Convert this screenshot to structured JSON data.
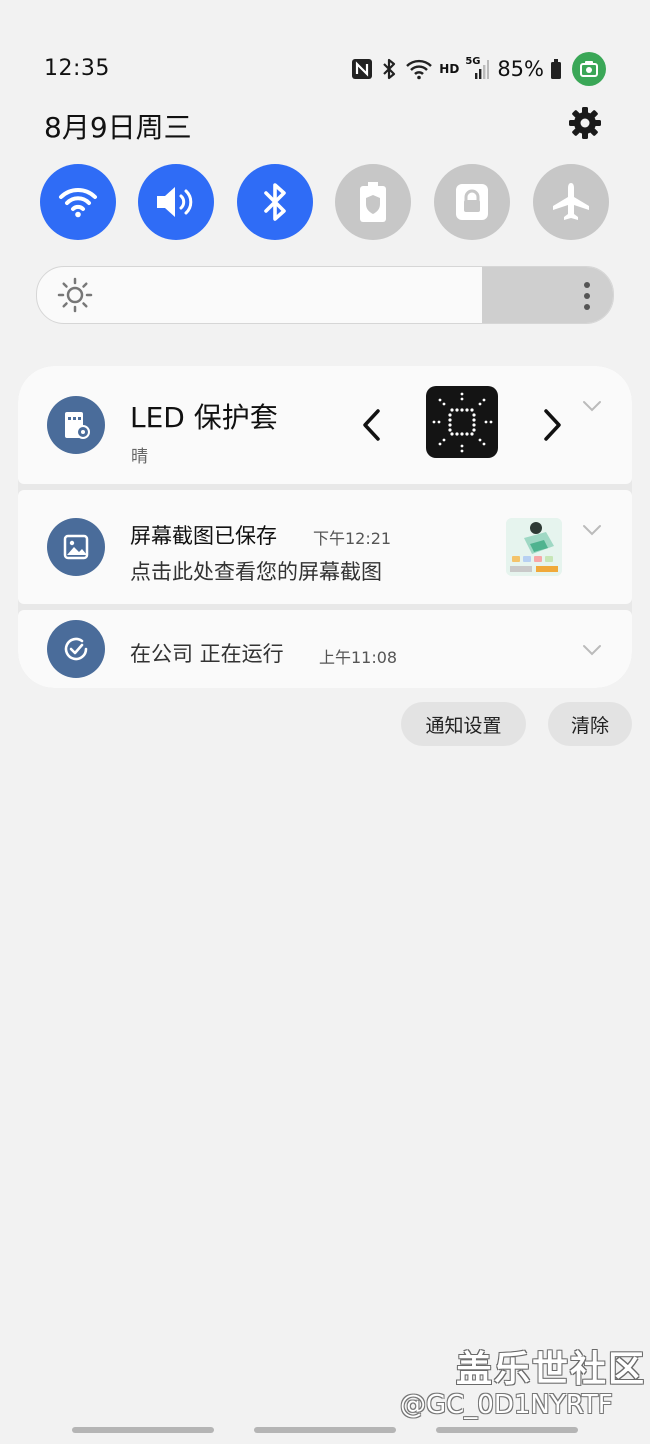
{
  "status_bar": {
    "time": "12:35",
    "network_hd": "HD",
    "network_5g": "5G",
    "battery": "85%",
    "icons": [
      "nfc-icon",
      "bluetooth-icon",
      "wifi-icon",
      "hd-icon",
      "5g-signal-icon",
      "battery-icon",
      "screen-recorder-icon"
    ]
  },
  "header": {
    "date": "8月9日周三",
    "settings_icon": "gear-icon"
  },
  "quick_settings": [
    {
      "name": "wifi",
      "icon": "wifi-icon",
      "state": "on"
    },
    {
      "name": "sound",
      "icon": "speaker-icon",
      "state": "on"
    },
    {
      "name": "bluetooth",
      "icon": "bluetooth-icon",
      "state": "on"
    },
    {
      "name": "battery-protect",
      "icon": "battery-shield-icon",
      "state": "off"
    },
    {
      "name": "secure-folder",
      "icon": "lock-icon",
      "state": "off"
    },
    {
      "name": "airplane-mode",
      "icon": "airplane-icon",
      "state": "off"
    }
  ],
  "brightness": {
    "level": 0.79,
    "icon": "sun-icon",
    "more_icon": "more-vertical-icon"
  },
  "notifications": {
    "led": {
      "title": "LED 保护套",
      "subtitle": "晴"
    },
    "screenshot": {
      "title": "屏幕截图已保存",
      "time": "下午12:21",
      "body": "点击此处查看您的屏幕截图"
    },
    "running": {
      "title": "在公司 正在运行",
      "time": "上午11:08"
    }
  },
  "actions": {
    "settings_label": "通知设置",
    "clear_label": "清除"
  },
  "watermark": {
    "line1": "盖乐世社区",
    "line2": "@GC_0D1NYRTF"
  },
  "colors": {
    "accent": "#2f6cf6",
    "toggle_off": "#c7c7c7",
    "avatar": "#4a6c9a",
    "background": "#f2f2f2"
  }
}
